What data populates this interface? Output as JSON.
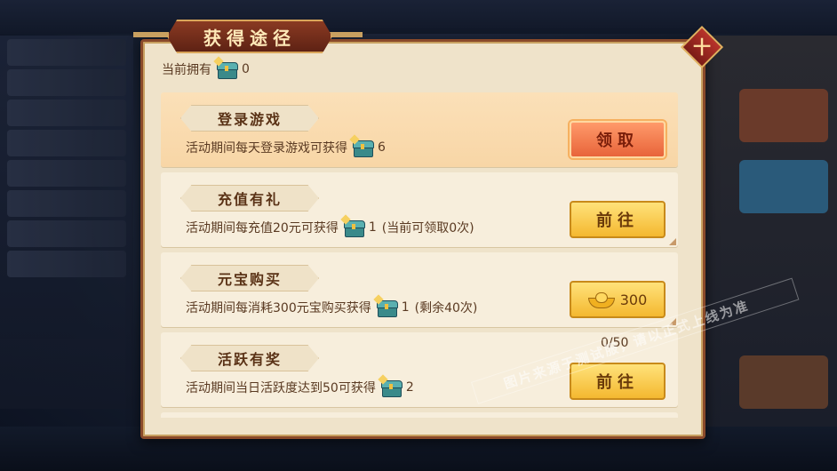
{
  "dialog": {
    "title": "获得途径",
    "close_label": "十",
    "own_label": "当前拥有",
    "own_icon": "treasure-chest-icon",
    "own_count": "0"
  },
  "tasks": [
    {
      "title": "登录游戏",
      "desc": "活动期间每天登录游戏可获得",
      "amount": "6",
      "extra": "",
      "button": "领取",
      "button_style": "red"
    },
    {
      "title": "充值有礼",
      "desc": "活动期间每充值20元可获得",
      "amount": "1",
      "extra": "(当前可领取0次)",
      "button": "前往",
      "button_style": "yellow"
    },
    {
      "title": "元宝购买",
      "desc": "活动期间每消耗300元宝购买获得",
      "amount": "1",
      "extra": "(剩余40次)",
      "button": "300",
      "button_icon": "gold-ingot-icon",
      "button_style": "gold"
    },
    {
      "title": "活跃有奖",
      "desc": "活动期间当日活跃度达到50可获得",
      "amount": "2",
      "extra": "",
      "button": "前往",
      "button_style": "yellow",
      "progress": "0/50"
    }
  ],
  "watermark": "图片来源于测试服，请以正式上线为准",
  "colors": {
    "dialog_bg": "#efe3ca",
    "border": "#8a4a2a",
    "button_yellow": "#f4b830",
    "button_red": "#e8643a"
  }
}
